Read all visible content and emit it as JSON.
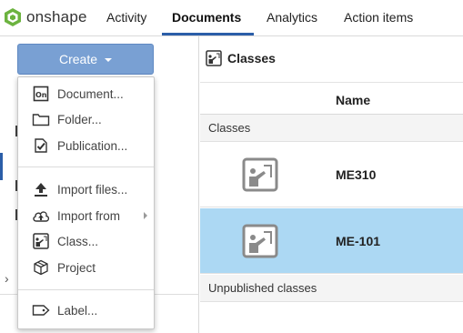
{
  "app": {
    "logo_text": "onshape",
    "brand_color": "#6cb33f"
  },
  "nav": {
    "tabs": [
      {
        "label": "Activity",
        "active": false
      },
      {
        "label": "Documents",
        "active": true
      },
      {
        "label": "Analytics",
        "active": false
      },
      {
        "label": "Action items",
        "active": false
      }
    ],
    "active_color": "#2b5ea8"
  },
  "toolbar": {
    "create_label": "Create",
    "create_icon": "caret-down-icon",
    "create_color": "#79a0d3"
  },
  "content": {
    "title": "Classes",
    "title_icon": "class-icon"
  },
  "table": {
    "columns": [
      "Name"
    ],
    "groups": [
      {
        "label": "Classes",
        "rows": [
          {
            "name": "ME310",
            "icon": "class-icon",
            "selected": false
          },
          {
            "name": "ME-101",
            "icon": "class-icon",
            "selected": true
          }
        ]
      },
      {
        "label": "Unpublished classes",
        "rows": []
      }
    ],
    "selected_color": "#acd8f3"
  },
  "create_menu": {
    "sections": [
      [
        {
          "label": "Document...",
          "icon": "onshape-document-icon",
          "submenu": false
        },
        {
          "label": "Folder...",
          "icon": "folder-icon",
          "submenu": false
        },
        {
          "label": "Publication...",
          "icon": "publication-icon",
          "submenu": false
        }
      ],
      [
        {
          "label": "Import files...",
          "icon": "upload-icon",
          "submenu": false
        },
        {
          "label": "Import from",
          "icon": "cloud-upload-icon",
          "submenu": true
        },
        {
          "label": "Class...",
          "icon": "class-icon",
          "submenu": false
        },
        {
          "label": "Project",
          "icon": "project-box-icon",
          "submenu": false
        }
      ],
      [
        {
          "label": "Label...",
          "icon": "label-tag-icon",
          "submenu": false
        }
      ]
    ]
  }
}
